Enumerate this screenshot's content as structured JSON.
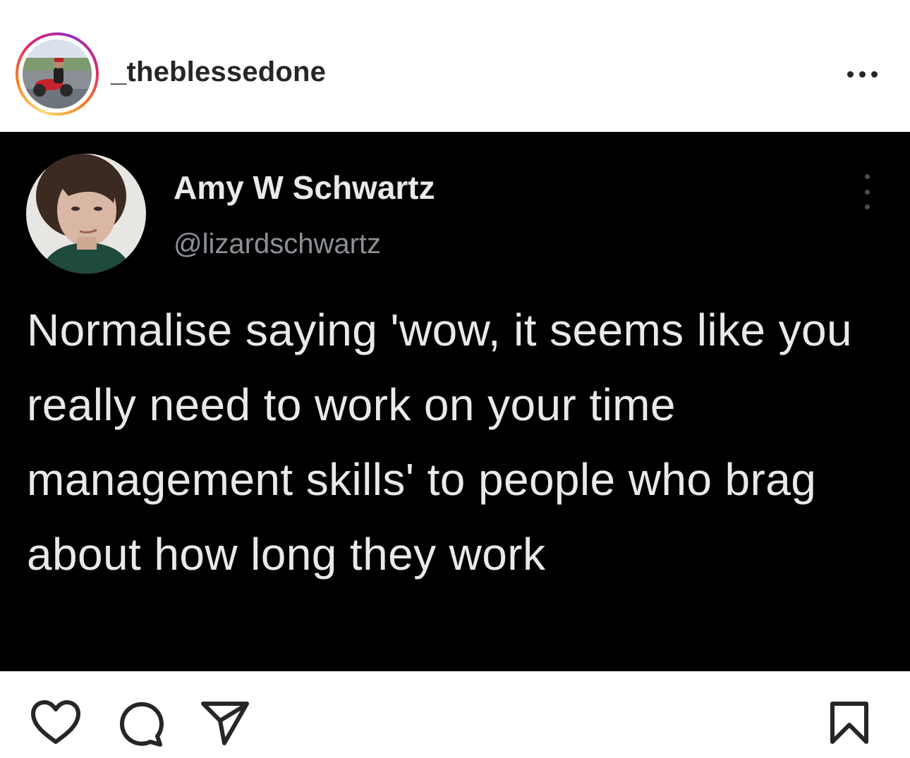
{
  "post": {
    "username": "_theblessedone",
    "more_icon": "more-horizontal-icon"
  },
  "tweet": {
    "display_name": "Amy W Schwartz",
    "handle": "@lizardschwartz",
    "text": "Normalise saying 'wow, it seems like you really need to work on your time management skills' to people who brag about how long they work",
    "menu_icon": "more-vertical-icon"
  },
  "actions": {
    "like_icon": "heart-icon",
    "comment_icon": "comment-icon",
    "share_icon": "send-icon",
    "save_icon": "bookmark-icon"
  },
  "colors": {
    "story_ring": [
      "#feda75",
      "#fa7e1e",
      "#d62976",
      "#962fbf"
    ],
    "tweet_background": "#000000",
    "tweet_text": "#e7e9ea",
    "tweet_handle": "#8b9096",
    "ui_text": "#262626"
  }
}
